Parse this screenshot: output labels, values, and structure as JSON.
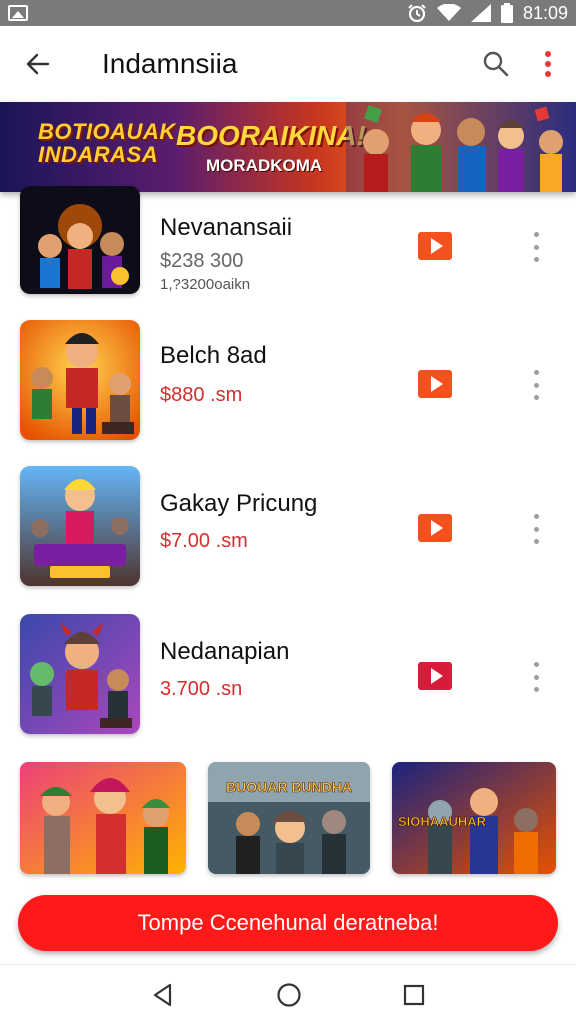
{
  "status_bar": {
    "time": "81:09",
    "icons": [
      "gallery-icon",
      "alarm-icon",
      "wifi-icon",
      "signal-icon",
      "battery-icon"
    ]
  },
  "app_bar": {
    "title": "Indamnsiia",
    "icons": [
      "back-arrow-icon",
      "search-icon",
      "more-vert-icon"
    ],
    "accent": "#e53935"
  },
  "banner": {
    "left_text": "BOTIOAUAK INDARASA",
    "headline": "BOORAIKINA!",
    "subline": "MORADKOMA"
  },
  "items": [
    {
      "name": "Nevanansaii",
      "price": "$238 300",
      "sub": "1,?3200oaikn",
      "price_style": "gray",
      "play_color": "#f4511e"
    },
    {
      "name": "Belch 8ad",
      "price": "$880 .sm",
      "sub": "",
      "price_style": "red",
      "play_color": "#f4511e"
    },
    {
      "name": "Gakay Pricung",
      "price": "$7.00 .sm",
      "sub": "",
      "price_style": "red",
      "play_color": "#f4511e"
    },
    {
      "name": "Nedanapian",
      "price": "3.700 .sn",
      "sub": "",
      "price_style": "red",
      "play_color": "#d81b3a"
    }
  ],
  "grid": {
    "labels": [
      "",
      "BUOUAR BUNDHA",
      "SIOHAAUHAR"
    ]
  },
  "cta": {
    "label": "Tompe Ccenehunal deratneba!"
  },
  "nav_bar": {
    "icons": [
      "back-triangle-icon",
      "home-circle-icon",
      "recents-square-icon"
    ]
  }
}
